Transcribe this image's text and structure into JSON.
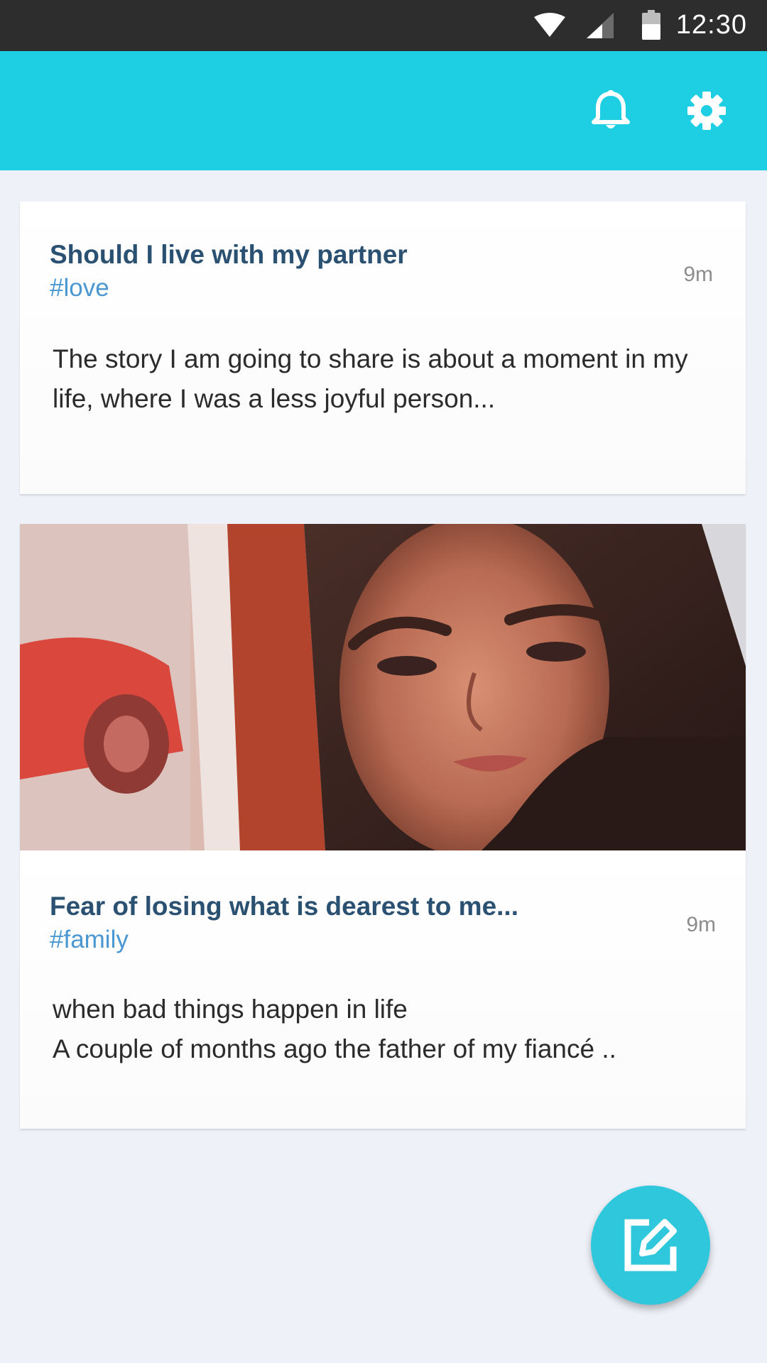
{
  "status_bar": {
    "time": "12:30",
    "icons": [
      "wifi-icon",
      "signal-icon",
      "battery-icon"
    ]
  },
  "app_bar": {
    "background_color": "#1ecfe4",
    "actions": [
      {
        "icon": "bell-icon",
        "label": "notifications"
      },
      {
        "icon": "gear-icon",
        "label": "settings"
      }
    ]
  },
  "posts": [
    {
      "title": "Should I live with my partner",
      "tag": "#love",
      "time": "9m",
      "excerpt": "The story I am going to share is about a moment in my life, where I was a less joyful person..."
    },
    {
      "title": "Fear of losing what is dearest to me...",
      "tag": "#family",
      "time": "9m",
      "excerpt": "when bad things happen in life\n A couple of months ago the father of my fiancé ..",
      "image": "portrait-photo"
    }
  ],
  "fab": {
    "icon": "edit-icon",
    "label": "compose"
  }
}
